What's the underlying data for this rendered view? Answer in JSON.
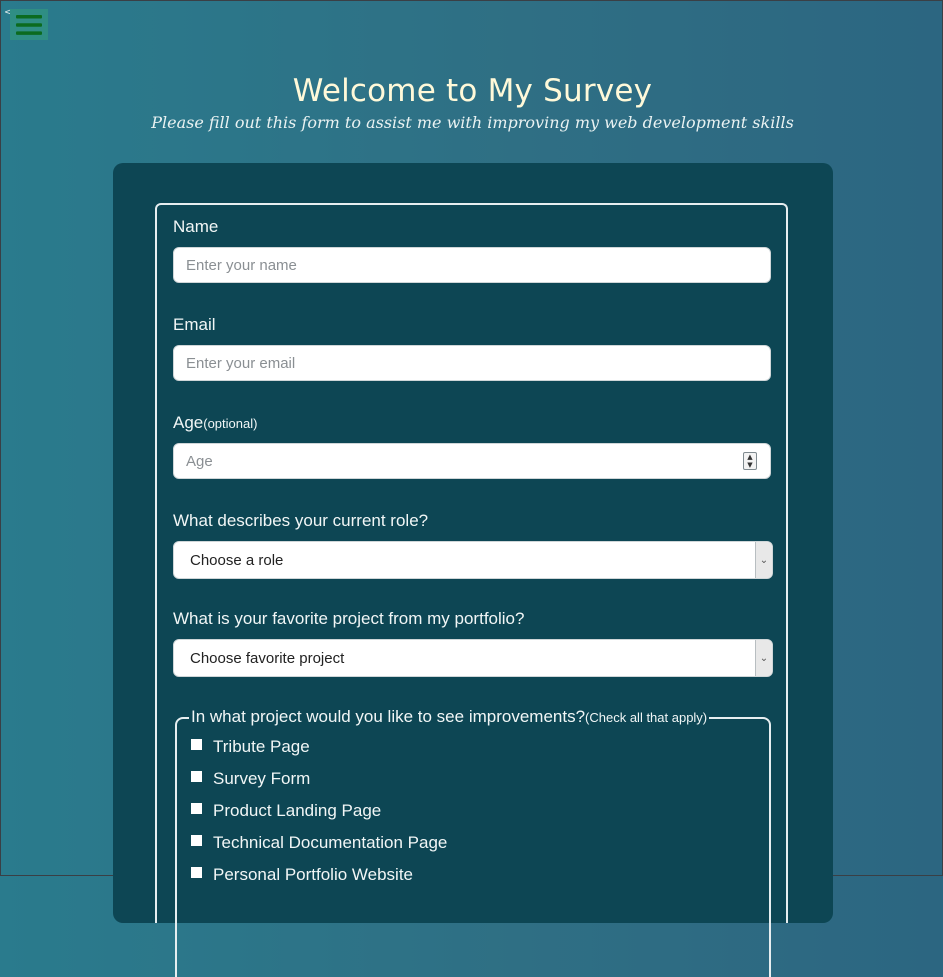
{
  "nav": {
    "back_caret": "<",
    "menu_color": "#1a7a2e"
  },
  "header": {
    "title": "Welcome to My Survey",
    "subtitle": "Please fill out this form to assist me with improving my web development skills"
  },
  "form": {
    "name": {
      "label": "Name",
      "placeholder": "Enter your name",
      "value": ""
    },
    "email": {
      "label": "Email",
      "placeholder": "Enter your email",
      "value": ""
    },
    "age": {
      "label": "Age",
      "optional": "(optional)",
      "placeholder": "Age",
      "value": ""
    },
    "role": {
      "label": "What describes your current role?",
      "selected": "Choose a role"
    },
    "favorite_project": {
      "label": "What is your favorite project from my portfolio?",
      "selected": "Choose favorite project"
    },
    "improvements": {
      "legend": "In what project would you like to see improvements?",
      "legend_note": "(Check all that apply)",
      "options": [
        {
          "label": "Tribute Page",
          "checked": false
        },
        {
          "label": "Survey Form",
          "checked": false
        },
        {
          "label": "Product Landing Page",
          "checked": false
        },
        {
          "label": "Technical Documentation Page",
          "checked": false
        },
        {
          "label": "Personal Portfolio Website",
          "checked": false
        }
      ]
    }
  },
  "colors": {
    "page_bg": "#2a7b8d",
    "card_bg": "#0d4654",
    "title": "#fff9d9"
  }
}
